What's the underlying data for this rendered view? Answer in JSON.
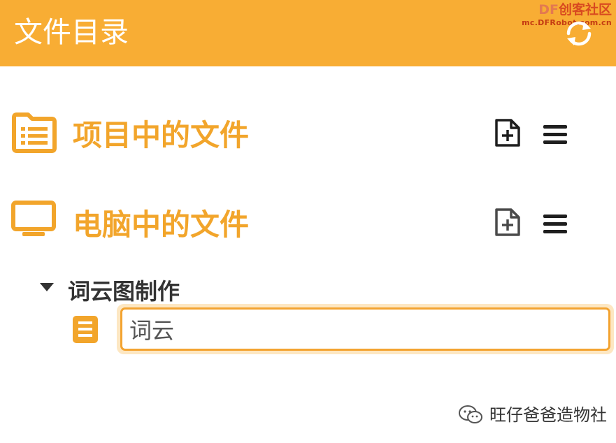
{
  "header": {
    "title": "文件目录",
    "refresh_icon": "refresh-icon",
    "watermark": {
      "brand_df": "DF",
      "brand_text": "创客社区",
      "site": "mc.DFRobot.com.cn"
    }
  },
  "sections": {
    "project": {
      "icon": "folder-list-icon",
      "title": "项目中的文件",
      "new_file_icon": "file-plus-icon",
      "menu_icon": "hamburger-menu-icon"
    },
    "computer": {
      "icon": "monitor-icon",
      "title": "电脑中的文件",
      "new_file_icon": "file-plus-icon",
      "menu_icon": "hamburger-menu-icon"
    }
  },
  "tree": {
    "expand_icon": "caret-down-icon",
    "folder_label": "词云图制作",
    "file_icon": "document-icon",
    "rename_input_value": "词云"
  },
  "footer_watermark": {
    "icon": "wechat-icon",
    "account": "旺仔爸爸造物社"
  },
  "colors": {
    "header_bg": "#f8ad34",
    "accent": "#f2a52b",
    "input_focus_ring": "#fde7c2",
    "input_border": "#f3a330"
  }
}
